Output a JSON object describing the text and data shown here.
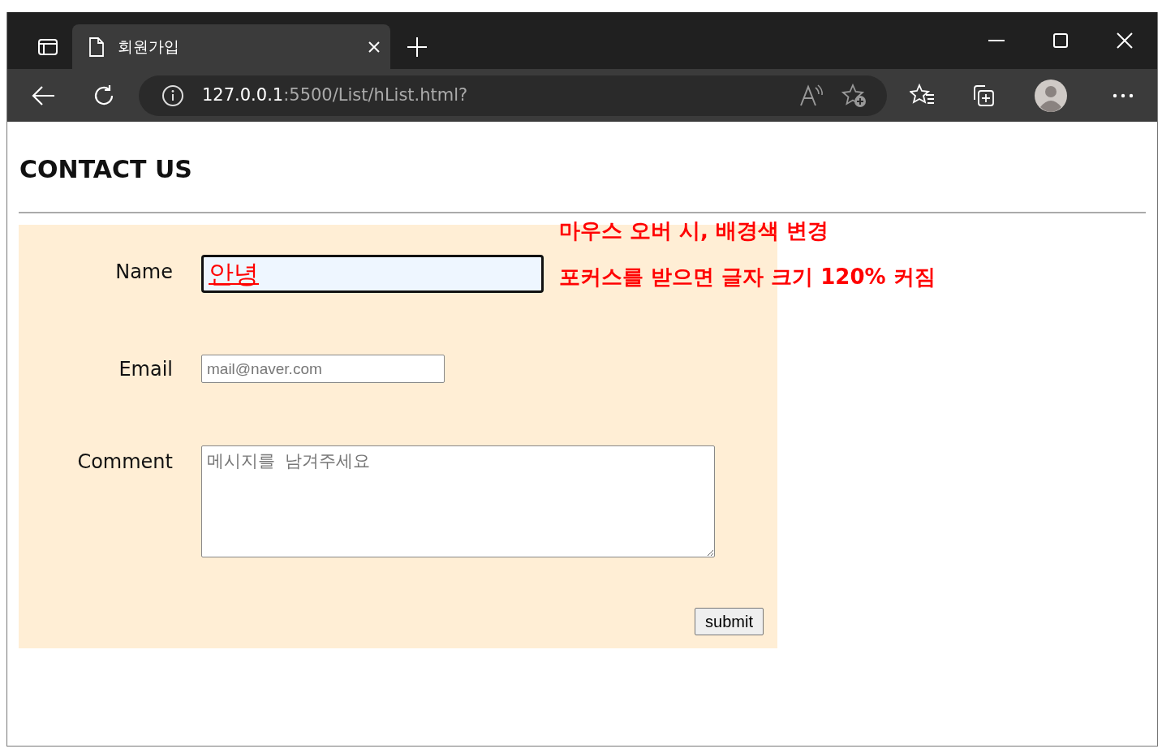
{
  "browser": {
    "tab_title": "회원가입",
    "url_host": "127.0.0.1",
    "url_path": ":5500/List/hList.html?"
  },
  "page": {
    "heading": "CONTACT US",
    "fields": [
      {
        "kind": "input",
        "label": "Name",
        "value": "안녕",
        "focused": true
      },
      {
        "kind": "input",
        "label": "Email",
        "placeholder": "mail@naver.com",
        "focused": false
      },
      {
        "kind": "textarea",
        "label": "Comment",
        "placeholder": "메시지를  남겨주세요",
        "focused": false
      }
    ],
    "submit": "submit"
  },
  "annotations": [
    "마우스 오버 시, 배경색 변경",
    "포커스를 받으면 글자 크기 120% 커짐"
  ]
}
